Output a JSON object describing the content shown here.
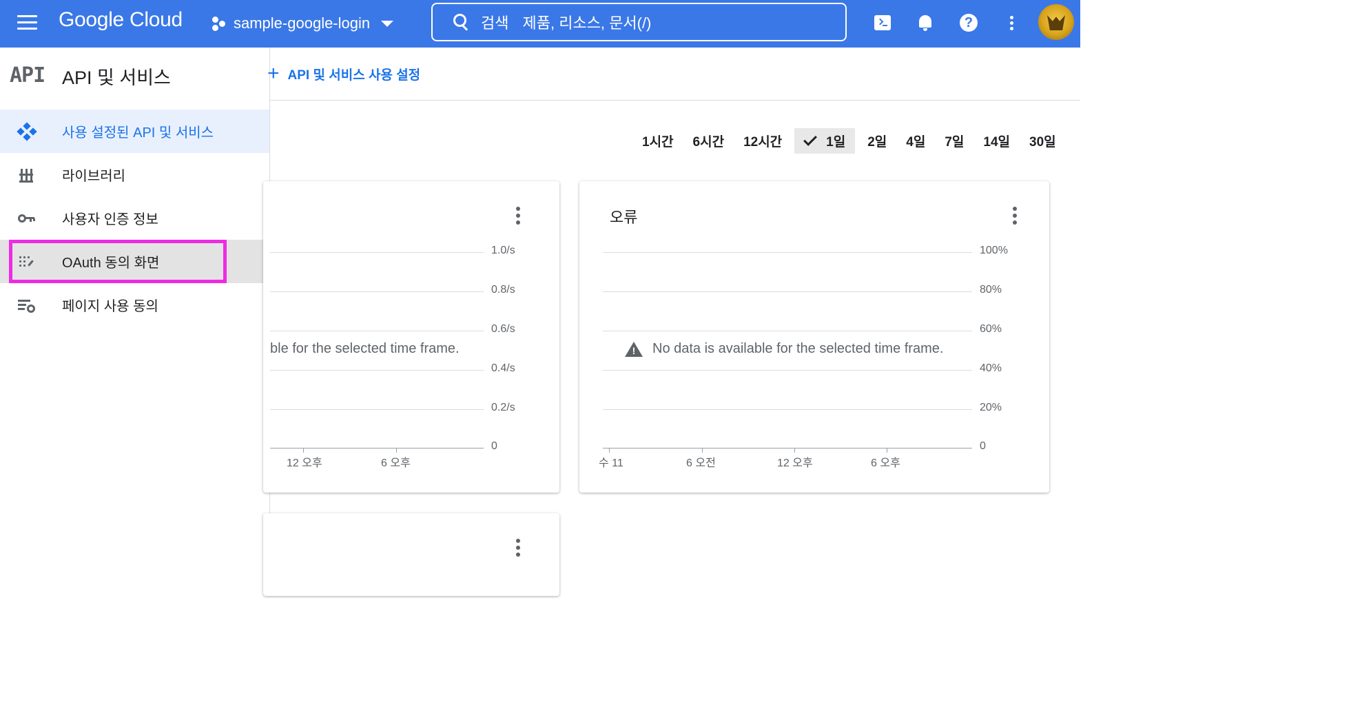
{
  "topbar": {
    "brand": "Google Cloud",
    "project_name": "sample-google-login",
    "search_label": "검색",
    "search_placeholder": "제품, 리소스, 문서(/)",
    "primary_color": "#3b78e7"
  },
  "sidebar": {
    "logo_text": "API",
    "title": "API 및 서비스",
    "items": [
      {
        "label": "사용 설정된 API 및 서비스",
        "icon": "api-diamond-icon",
        "state": "active"
      },
      {
        "label": "라이브러리",
        "icon": "library-icon",
        "state": "normal"
      },
      {
        "label": "사용자 인증 정보",
        "icon": "key-icon",
        "state": "normal"
      },
      {
        "label": "OAuth 동의 화면",
        "icon": "oauth-consent-icon",
        "state": "highlighted"
      },
      {
        "label": "페이지 사용 동의",
        "icon": "page-consent-gear-icon",
        "state": "normal"
      }
    ],
    "highlight_color": "#ee2be3"
  },
  "main": {
    "enable_button_label": "API 및 서비스 사용 설정",
    "time_ranges": [
      "1시간",
      "6시간",
      "12시간",
      "1일",
      "2일",
      "4일",
      "7일",
      "14일",
      "30일"
    ],
    "selected_time_range": "1일",
    "cards": {
      "left": {
        "title": "",
        "no_data_text": "ble for the selected time frame.",
        "y_ticks": [
          "1.0/s",
          "0.8/s",
          "0.6/s",
          "0.4/s",
          "0.2/s",
          "0"
        ],
        "x_ticks": [
          "12 오후",
          "6 오후"
        ]
      },
      "right": {
        "title": "오류",
        "no_data_text": "No data is available for the selected time frame.",
        "y_ticks": [
          "100%",
          "80%",
          "60%",
          "40%",
          "20%",
          "0"
        ],
        "x_ticks": [
          "수 11",
          "6 오전",
          "12 오후",
          "6 오후"
        ]
      }
    }
  }
}
